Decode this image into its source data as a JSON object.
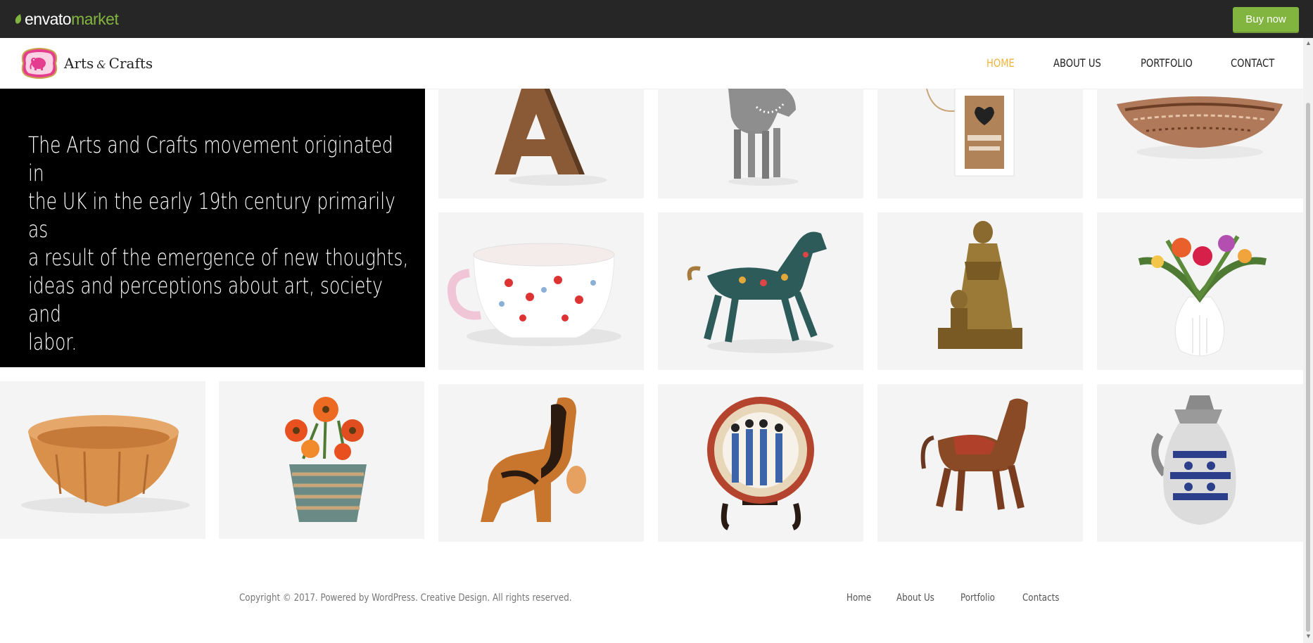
{
  "envato": {
    "logo_word": "envato",
    "logo_market": "market",
    "buy_label": "Buy now"
  },
  "site": {
    "brand": {
      "name_left": "Arts",
      "name_amp": "&",
      "name_right": "Crafts"
    },
    "nav": [
      {
        "label": "HOME",
        "active": true
      },
      {
        "label": "ABOUT US",
        "active": false
      },
      {
        "label": "PORTFOLIO",
        "active": false
      },
      {
        "label": "CONTACT",
        "active": false
      }
    ]
  },
  "intro": {
    "line1": "The Arts and Crafts movement originated in",
    "line2": "the UK in the early 19th century primarily as",
    "line3": "a result of the emergence of new thoughts,",
    "line4": "ideas and perceptions about art, society and",
    "line5": "labor."
  },
  "gallery": {
    "items": [
      {
        "subject": "wooden-letter-a"
      },
      {
        "subject": "painted-horse-figure"
      },
      {
        "subject": "wooden-birdhouse-home"
      },
      {
        "subject": "woven-basket-bowl"
      },
      {
        "subject": "floral-teacup"
      },
      {
        "subject": "cloisonne-horse"
      },
      {
        "subject": "bronze-statue"
      },
      {
        "subject": "flower-vase"
      },
      {
        "subject": "bamboo-bowl"
      },
      {
        "subject": "flowers-in-basket"
      },
      {
        "subject": "wooden-elephant"
      },
      {
        "subject": "decorative-plate"
      },
      {
        "subject": "wooden-horse"
      },
      {
        "subject": "stoneware-jug"
      }
    ],
    "colors": {
      "tile_bg": "#f4f4f4",
      "wood": "#8a5a36",
      "bronze": "#8a6a2e"
    }
  },
  "footer": {
    "copyright": "Copyright © 2017. Powered by WordPress. Creative Design. All rights reserved.",
    "links": [
      "Home",
      "About Us",
      "Portfolio",
      "Contacts"
    ]
  },
  "colors": {
    "envato_bar": "#262626",
    "envato_green": "#82b440",
    "nav_active": "#f0b43c",
    "intro_bg": "#000000"
  }
}
